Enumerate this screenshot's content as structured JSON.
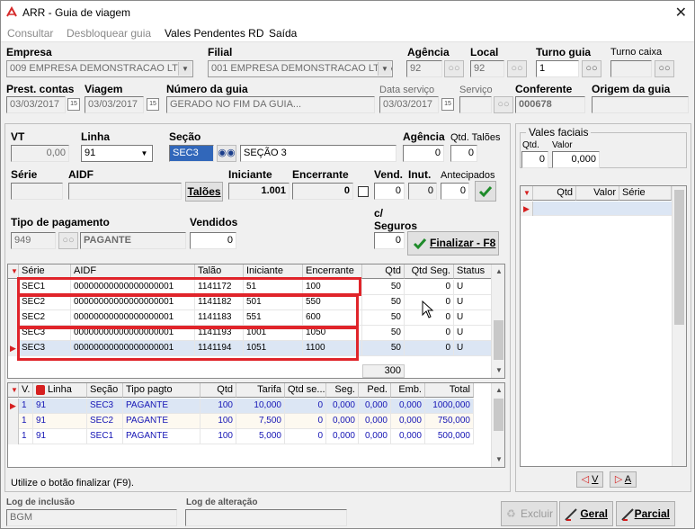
{
  "window": {
    "title": "ARR - Guia de viagem",
    "close": "✕"
  },
  "menu": {
    "consultar": "Consultar",
    "desbloquear": "Desbloquear guia",
    "vales": "Vales Pendentes RD",
    "saida": "Saída"
  },
  "header": {
    "empresa_label": "Empresa",
    "empresa_value": "009 EMPRESA DEMONSTRACAO LTDA",
    "filial_label": "Filial",
    "filial_value": "001 EMPRESA DEMONSTRACAO LTDA",
    "agencia_label": "Agência",
    "agencia_value": "92",
    "local_label": "Local",
    "local_value": "92",
    "turno_guia_label": "Turno guia",
    "turno_guia_value": "1",
    "turno_caixa_label": "Turno caixa",
    "turno_caixa_value": "",
    "prest_label": "Prest. contas",
    "prest_value": "03/03/2017",
    "viagem_label": "Viagem",
    "viagem_value": "03/03/2017",
    "numero_label": "Número da guia",
    "numero_value": "GERADO NO FIM DA GUIA...",
    "data_servico_label": "Data serviço",
    "data_servico_value": "03/03/2017",
    "servico_label": "Serviço",
    "servico_value": "",
    "conferente_label": "Conferente",
    "conferente_value": "000678",
    "origem_label": "Origem da guia",
    "origem_value": ""
  },
  "form": {
    "vt_label": "VT",
    "vt_value": "0,00",
    "linha_label": "Linha",
    "linha_value": "91",
    "secao_label": "Seção",
    "secao_code": "SEC3",
    "secao_name": "SEÇÃO 3",
    "agencia_label": "Agência",
    "agencia_value": "0",
    "qtd_taloes_label": "Qtd. Talões",
    "qtd_taloes_value": "0",
    "serie_label": "Série",
    "serie_value": "",
    "aidf_label": "AIDF",
    "aidf_value": "",
    "taloes_button": "Talões",
    "iniciante_label": "Iniciante",
    "iniciante_value": "1.001",
    "encerrante_label": "Encerrante",
    "encerrante_value": "0",
    "vend_label": "Vend.",
    "vend_value": "0",
    "inut_label": "Inut.",
    "inut_value": "0",
    "antecipados_label": "Antecipados",
    "antecipados_value": "0",
    "tipo_pag_label": "Tipo de pagamento",
    "tipo_pag_code": "949",
    "tipo_pag_name": "PAGANTE",
    "vendidos_label": "Vendidos",
    "vendidos_value": "0",
    "seguros_label_1": "c/",
    "seguros_label_2": "Seguros",
    "seguros_value": "0",
    "finalizar_button": "Finalizar - F8"
  },
  "taloes_table": {
    "columns": [
      "Série",
      "AIDF",
      "Talão",
      "Iniciante",
      "Encerrante",
      "Qtd",
      "Qtd Seg.",
      "Status"
    ],
    "rows": [
      [
        "SEC1",
        "00000000000000000001",
        "1141172",
        "51",
        "100",
        "50",
        "0",
        "U"
      ],
      [
        "SEC2",
        "00000000000000000001",
        "1141182",
        "501",
        "550",
        "50",
        "0",
        "U"
      ],
      [
        "SEC2",
        "00000000000000000001",
        "1141183",
        "551",
        "600",
        "50",
        "0",
        "U"
      ],
      [
        "SEC3",
        "00000000000000000001",
        "1141193",
        "1001",
        "1050",
        "50",
        "0",
        "U"
      ],
      [
        "SEC3",
        "00000000000000000001",
        "1141194",
        "1051",
        "1100",
        "50",
        "0",
        "U"
      ]
    ],
    "total_qtd": "300"
  },
  "resumo_table": {
    "columns": [
      "V.",
      "Linha",
      "Seção",
      "Tipo pagto",
      "Qtd",
      "Tarifa",
      "Qtd se...",
      "Seg.",
      "Ped.",
      "Emb.",
      "Total"
    ],
    "rows": [
      [
        "1",
        "91",
        "SEC3",
        "PAGANTE",
        "100",
        "10,000",
        "0",
        "0,000",
        "0,000",
        "0,000",
        "1000,000"
      ],
      [
        "1",
        "91",
        "SEC2",
        "PAGANTE",
        "100",
        "7,500",
        "0",
        "0,000",
        "0,000",
        "0,000",
        "750,000"
      ],
      [
        "1",
        "91",
        "SEC1",
        "PAGANTE",
        "100",
        "5,000",
        "0",
        "0,000",
        "0,000",
        "0,000",
        "500,000"
      ]
    ]
  },
  "hint": "Utilize o botão finalizar (F9).",
  "vales": {
    "title": "Vales faciais",
    "qtd_label": "Qtd.",
    "qtd_value": "0",
    "valor_label": "Valor",
    "valor_value": "0,000",
    "columns": [
      "Qtd",
      "Valor",
      "Série"
    ],
    "nav_v": "V",
    "nav_a": "A"
  },
  "footer": {
    "log_inclusao_label": "Log de inclusão",
    "log_inclusao_value": "BGM",
    "log_alteracao_label": "Log de alteração",
    "log_alteracao_value": "",
    "excluir": "Excluir",
    "geral": "Geral",
    "parcial": "Parcial"
  },
  "colors": {
    "accent": "#3167ba",
    "highlight_box": "#e0242a",
    "grid_text_blue": "#1515b5",
    "check_green": "#1e8b2a"
  }
}
